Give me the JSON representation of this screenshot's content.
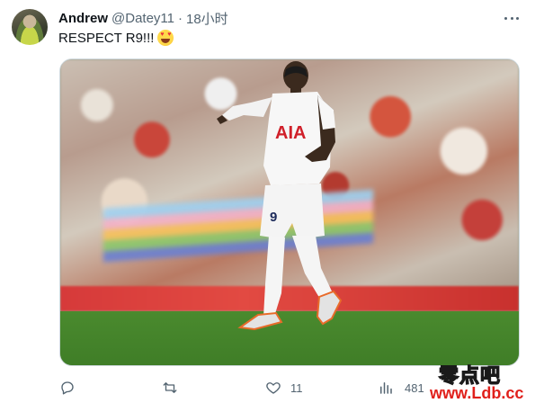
{
  "tweet": {
    "author_name": "Andrew",
    "handle": "@Datey11",
    "separator": "·",
    "time": "18小时",
    "text": "RESPECT R9!!!",
    "emoji": "heart-eyes-emoji"
  },
  "actions": {
    "reply_count": "",
    "retweet_count": "",
    "like_count": "11",
    "views_count": "481"
  },
  "watermark": {
    "text1": "零点吧",
    "text2": "www.Ldb.cc"
  },
  "colors": {
    "text_primary": "#0f1419",
    "text_secondary": "#536471",
    "watermark_red": "#e0201b"
  }
}
